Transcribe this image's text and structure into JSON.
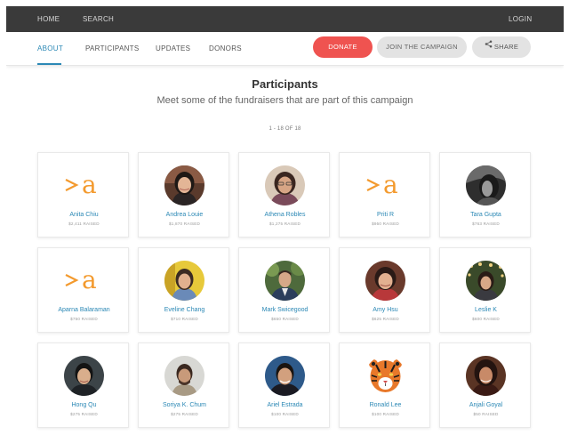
{
  "topbar": {
    "home": "HOME",
    "search": "SEARCH",
    "login": "LOGIN"
  },
  "tabs": {
    "about": "ABOUT",
    "participants": "PARTICIPANTS",
    "updates": "UPDATES",
    "donors": "DONORS"
  },
  "actions": {
    "donate": "DONATE",
    "join": "JOIN THE CAMPAIGN",
    "share": "SHARE"
  },
  "colors": {
    "accent": "#2b88b5",
    "donate": "#ef5350",
    "logo": "#f39a2e",
    "topbar": "#3a3a3a"
  },
  "page": {
    "title": "Participants",
    "subtitle": "Meet some of the fundraisers that are part of this campaign",
    "counter": "1 - 18 OF 18"
  },
  "participants": [
    {
      "name": "Anita Chiu",
      "raised": "$2,411 RAISED",
      "image": "logo"
    },
    {
      "name": "Andrea Louie",
      "raised": "$1,870 RAISED",
      "image": "photo"
    },
    {
      "name": "Athena Robles",
      "raised": "$1,275 RAISED",
      "image": "photo"
    },
    {
      "name": "Priti R",
      "raised": "$950 RAISED",
      "image": "logo"
    },
    {
      "name": "Tara Gupta",
      "raised": "$763 RAISED",
      "image": "photo"
    },
    {
      "name": "Aparna Balaraman",
      "raised": "$750 RAISED",
      "image": "logo"
    },
    {
      "name": "Eveline Chang",
      "raised": "$710 RAISED",
      "image": "photo"
    },
    {
      "name": "Mark Swicegood",
      "raised": "$650 RAISED",
      "image": "photo"
    },
    {
      "name": "Amy Hsu",
      "raised": "$625 RAISED",
      "image": "photo"
    },
    {
      "name": "Leslie K",
      "raised": "$600 RAISED",
      "image": "photo"
    },
    {
      "name": "Hong Qu",
      "raised": "$275 RAISED",
      "image": "photo"
    },
    {
      "name": "Soriya K. Chum",
      "raised": "$275 RAISED",
      "image": "photo"
    },
    {
      "name": "Ariel Estrada",
      "raised": "$100 RAISED",
      "image": "photo"
    },
    {
      "name": "Ronald Lee",
      "raised": "$100 RAISED",
      "image": "tiger"
    },
    {
      "name": "Anjali Goyal",
      "raised": "$50 RAISED",
      "image": "photo"
    }
  ]
}
